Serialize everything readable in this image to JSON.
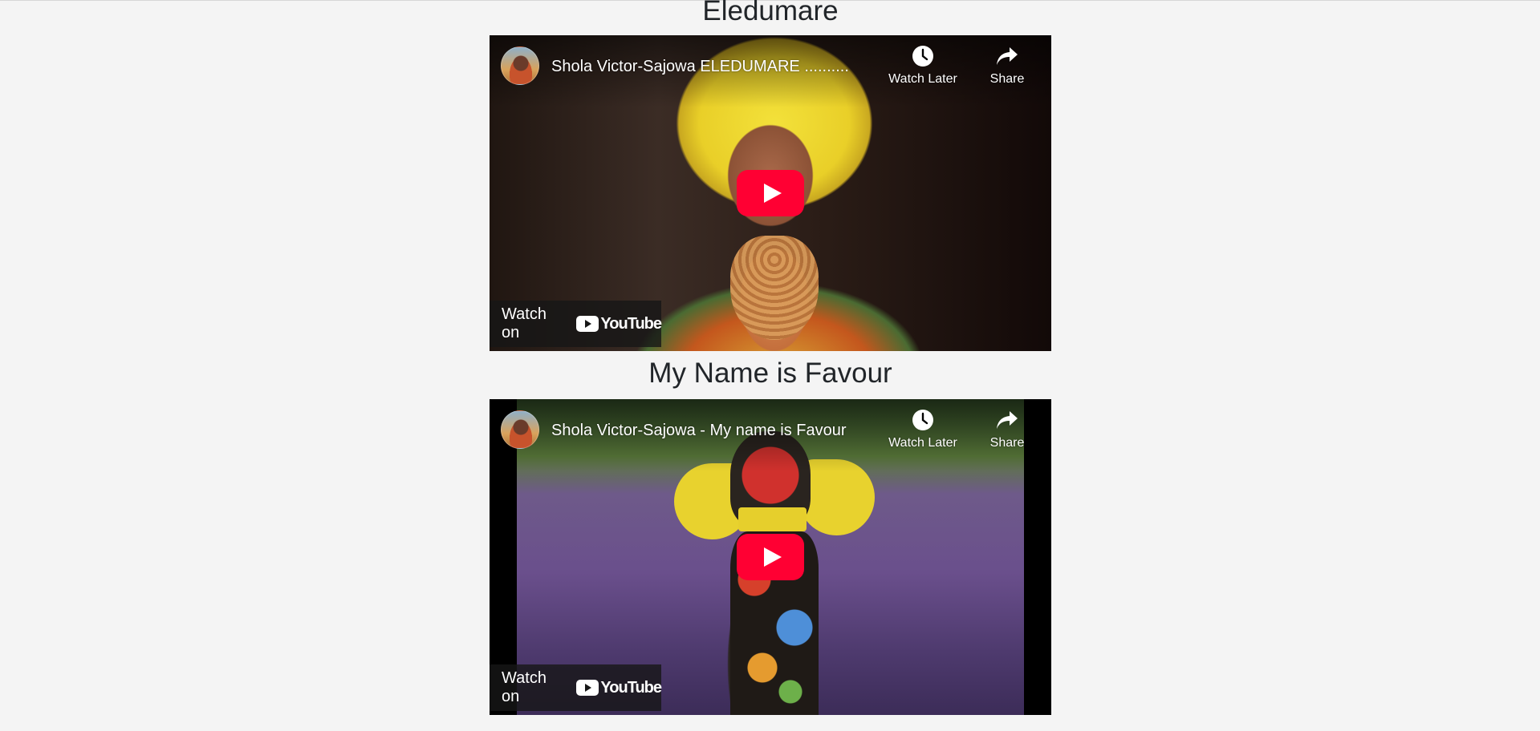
{
  "videos": [
    {
      "heading": "Eledumare",
      "title": "Shola Victor-Sajowa ELEDUMARE ..........",
      "watch_later_label": "Watch Later",
      "share_label": "Share",
      "watch_on_label": "Watch on",
      "youtube_label": "YouTube"
    },
    {
      "heading": "My Name is Favour",
      "title": "Shola Victor-Sajowa - My name is Favour",
      "watch_later_label": "Watch Later",
      "share_label": "Share",
      "watch_on_label": "Watch on",
      "youtube_label": "YouTube"
    }
  ],
  "colors": {
    "page_background": "#f4f4f4",
    "heading_text": "#212529",
    "youtube_red": "#ff0033",
    "overlay_bar": "#171717"
  },
  "icons": [
    "clock-icon",
    "share-arrow-icon",
    "play-button-icon",
    "youtube-logo-icon"
  ]
}
